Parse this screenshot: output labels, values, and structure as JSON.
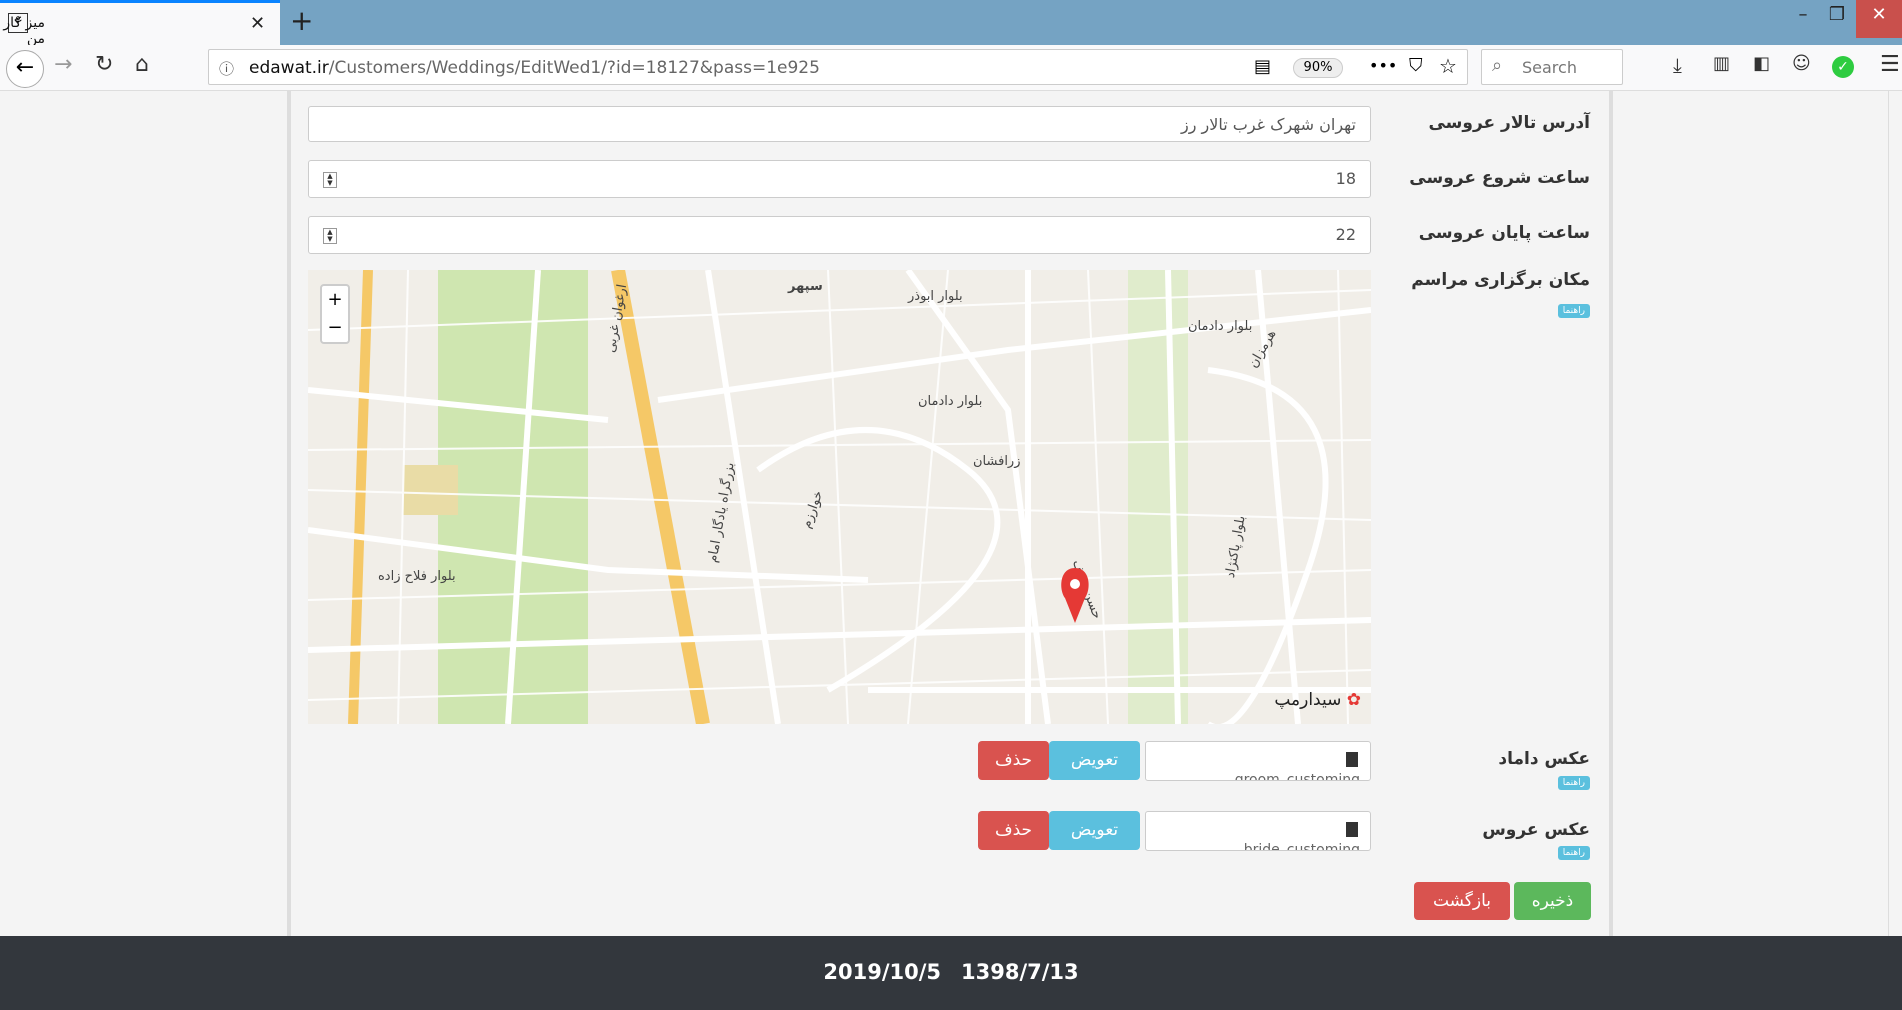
{
  "browser": {
    "tab_title": "میز کار من",
    "url_domain": "edawat.ir",
    "url_path": "/Customers/Weddings/EditWed1/?id=18127&pass=1e925",
    "zoom": "90%",
    "search_placeholder": "Search"
  },
  "form": {
    "hall_address": {
      "label": "آدرس تالار عروسی",
      "value": "تهران شهرک غرب تالار رز"
    },
    "start_time": {
      "label": "ساعت شروع عروسی",
      "value": "18"
    },
    "end_time": {
      "label": "ساعت پایان عروسی",
      "value": "22"
    },
    "location": {
      "label": "مکان برگزاری مراسم",
      "help": "راهنما"
    },
    "groom_photo": {
      "label": "عکس داماد",
      "help": "راهنما",
      "filename": "groom_customing",
      "replace": "تعویض",
      "delete": "حذف"
    },
    "bride_photo": {
      "label": "عکس عروس",
      "help": "راهنما",
      "filename": "bride_customing",
      "replace": "تعویض",
      "delete": "حذف"
    },
    "save": "ذخیره",
    "back": "بازگشت"
  },
  "map": {
    "zoom_in": "+",
    "zoom_out": "−",
    "provider": "سیدارمپ",
    "streets": [
      "سپهر",
      "بلوار ابوذر",
      "بلوار دادمان",
      "زرافشان",
      "بزرگراه یادگار امام",
      "ارغوان غربی",
      "بلوار فلاح زاده",
      "خوارزم",
      "بلوار پاکنژاد",
      "حسن سیف",
      "هرمزان",
      "بلوار دادمان"
    ]
  },
  "footer": {
    "gregorian": "2019/10/5",
    "persian": "1398/7/13"
  },
  "colors": {
    "danger": "#d9534f",
    "info": "#5bc0de",
    "success": "#5cb85c",
    "footer": "#33373d",
    "marker": "#e53935"
  }
}
